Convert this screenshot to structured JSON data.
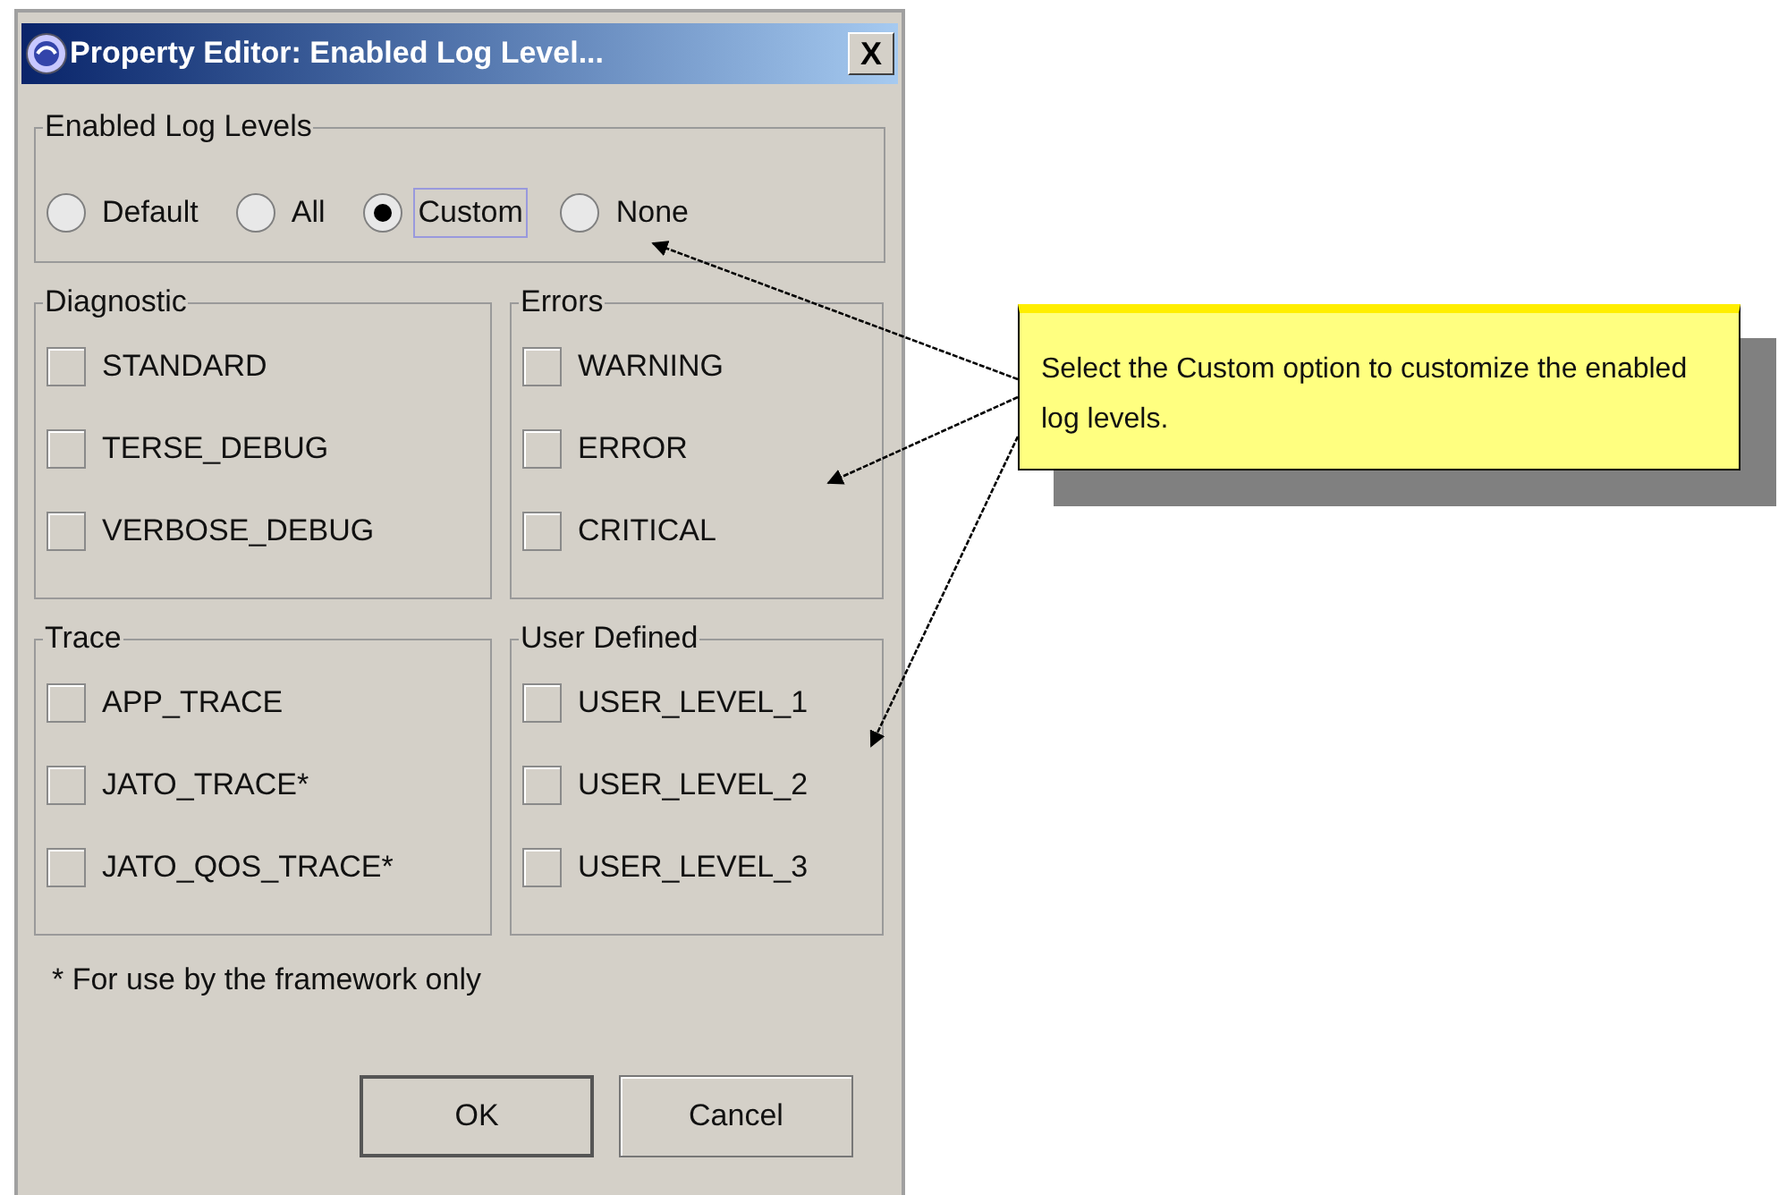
{
  "window": {
    "title": "Property Editor: Enabled Log Level...",
    "close": "X"
  },
  "log_levels": {
    "title": "Enabled Log Levels",
    "options": [
      {
        "label": "Default",
        "selected": false,
        "focused": false
      },
      {
        "label": "All",
        "selected": false,
        "focused": false
      },
      {
        "label": "Custom",
        "selected": true,
        "focused": true
      },
      {
        "label": "None",
        "selected": false,
        "focused": false
      }
    ]
  },
  "groups": [
    {
      "title": "Diagnostic",
      "items": [
        {
          "label": "STANDARD",
          "checked": false
        },
        {
          "label": "TERSE_DEBUG",
          "checked": false
        },
        {
          "label": "VERBOSE_DEBUG",
          "checked": false
        }
      ]
    },
    {
      "title": "Errors",
      "items": [
        {
          "label": "WARNING",
          "checked": false
        },
        {
          "label": "ERROR",
          "checked": false
        },
        {
          "label": "CRITICAL",
          "checked": false
        }
      ]
    },
    {
      "title": "Trace",
      "items": [
        {
          "label": "APP_TRACE",
          "checked": false
        },
        {
          "label": "JATO_TRACE*",
          "checked": false
        },
        {
          "label": "JATO_QOS_TRACE*",
          "checked": false
        }
      ]
    },
    {
      "title": "User Defined",
      "items": [
        {
          "label": "USER_LEVEL_1",
          "checked": false
        },
        {
          "label": "USER_LEVEL_2",
          "checked": false
        },
        {
          "label": "USER_LEVEL_3",
          "checked": false
        }
      ]
    }
  ],
  "footnote": "* For use by the framework only",
  "buttons": [
    {
      "label": "OK",
      "default": true
    },
    {
      "label": "Cancel",
      "default": false
    }
  ],
  "callout": {
    "text": "Select the Custom option to customize the enabled log levels."
  }
}
